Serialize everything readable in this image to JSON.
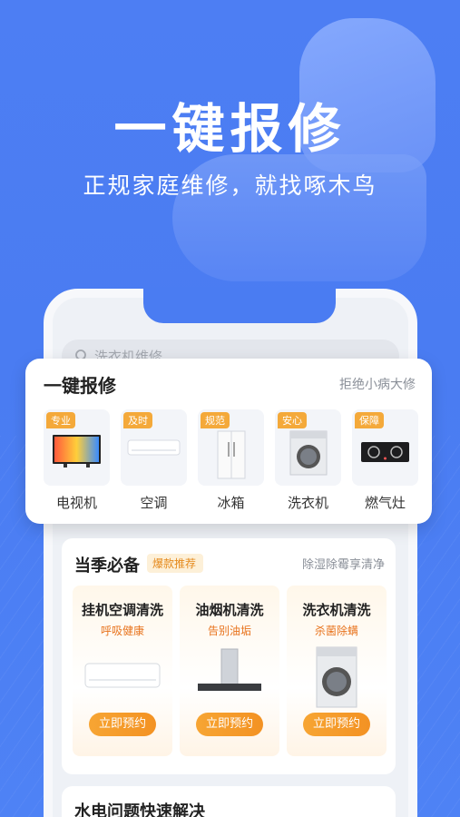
{
  "hero": {
    "title": "一键报修",
    "subtitle": "正规家庭维修，就找啄木鸟"
  },
  "search": {
    "placeholder": "洗衣机维修"
  },
  "repair": {
    "title": "一键报修",
    "slogan": "拒绝小病大修",
    "items": [
      {
        "tag": "专业",
        "label": "电视机",
        "icon": "tv-icon"
      },
      {
        "tag": "及时",
        "label": "空调",
        "icon": "air-conditioner-icon"
      },
      {
        "tag": "规范",
        "label": "冰箱",
        "icon": "fridge-icon"
      },
      {
        "tag": "安心",
        "label": "洗衣机",
        "icon": "washing-machine-icon"
      },
      {
        "tag": "保障",
        "label": "燃气灶",
        "icon": "gas-stove-icon"
      }
    ]
  },
  "season": {
    "title": "当季必备",
    "hot": "爆款推荐",
    "right": "除湿除霉享清净",
    "cards": [
      {
        "name": "挂机空调清洗",
        "desc": "呼吸健康",
        "button": "立即预约"
      },
      {
        "name": "油烟机清洗",
        "desc": "告别油垢",
        "button": "立即预约"
      },
      {
        "name": "洗衣机清洗",
        "desc": "杀菌除螨",
        "button": "立即预约"
      }
    ]
  },
  "bottom": {
    "title": "水电问题快速解决"
  },
  "colors": {
    "primary": "#4a7cf2",
    "accent": "#f39223",
    "tag": "#f4a93a"
  }
}
